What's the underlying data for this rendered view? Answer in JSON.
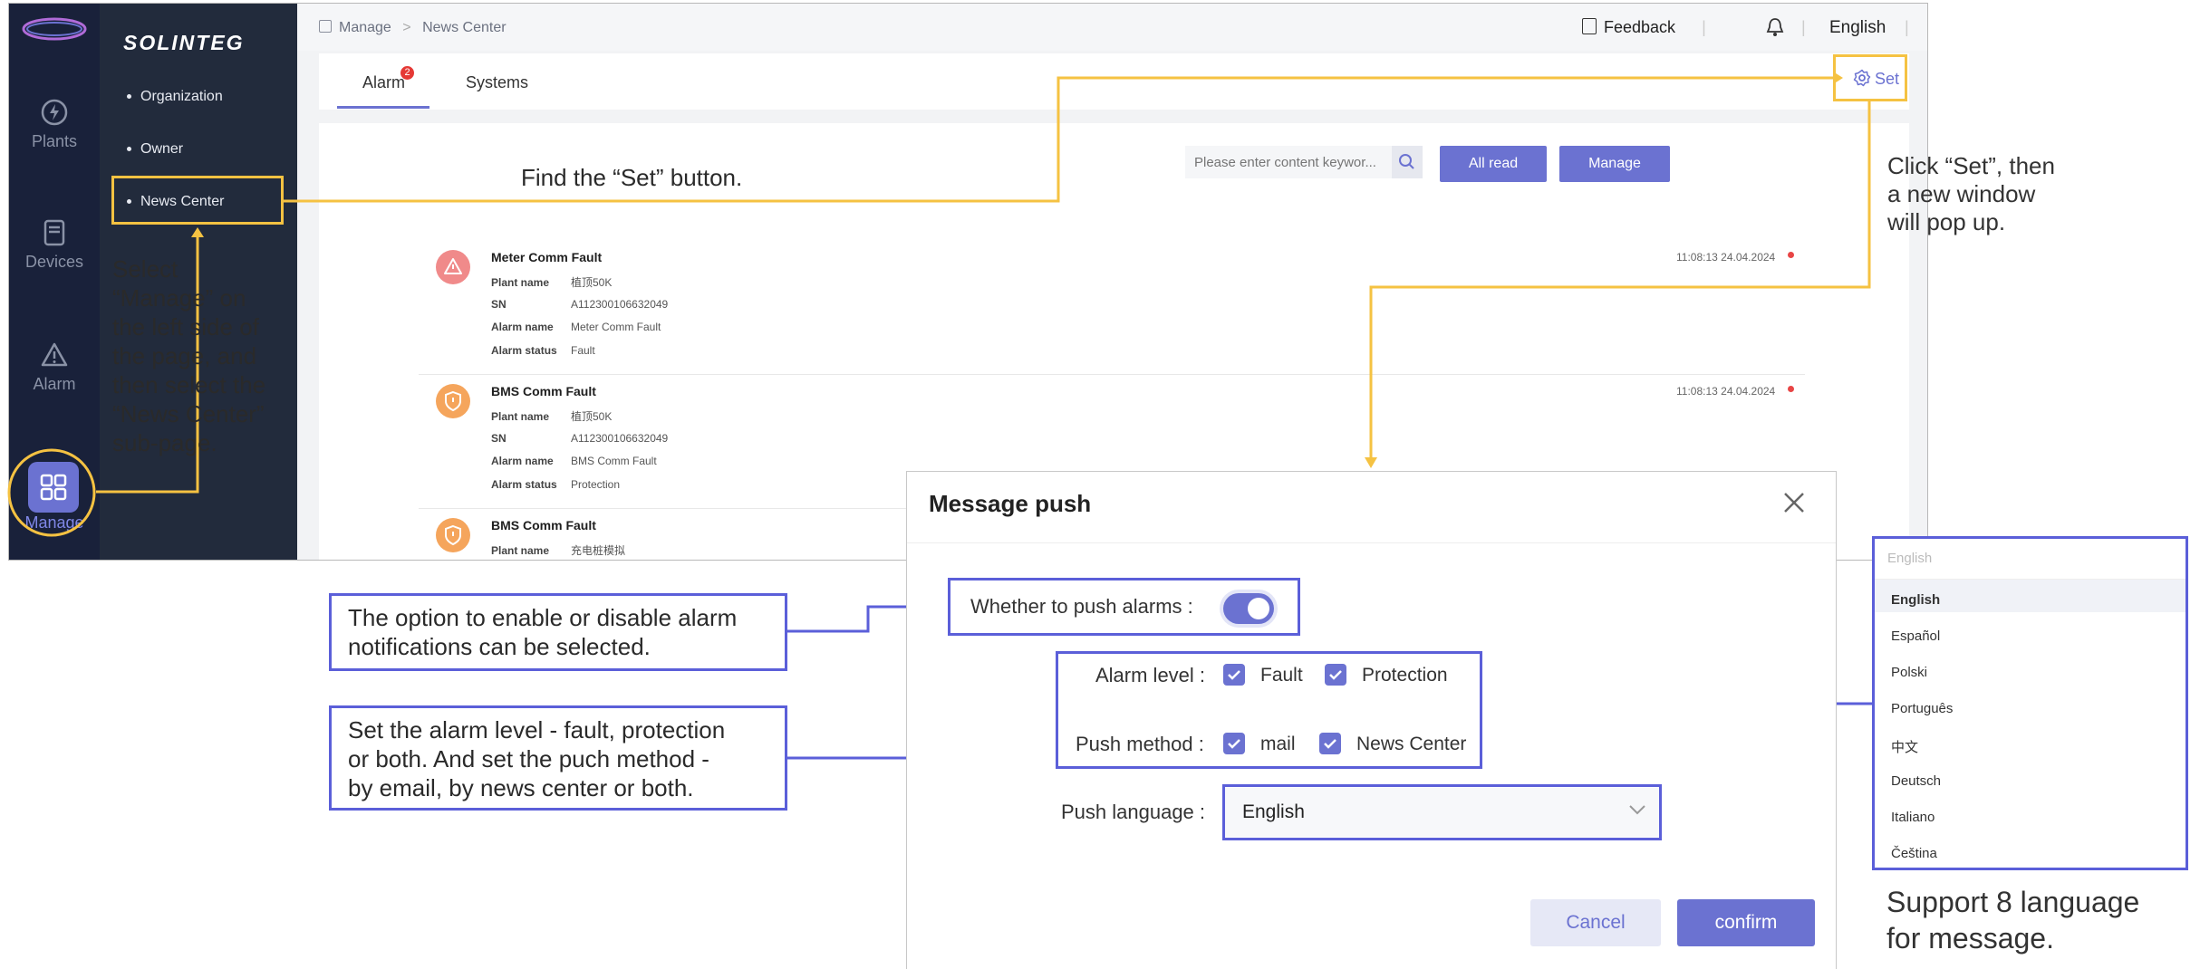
{
  "app": {
    "brand": "SOLINTEG",
    "rail": [
      {
        "label": "Plants",
        "icon": "plants-icon"
      },
      {
        "label": "Devices",
        "icon": "devices-icon"
      },
      {
        "label": "Alarm",
        "icon": "alarm-icon"
      },
      {
        "label": "Manage",
        "icon": "manage-icon"
      }
    ],
    "subnav": [
      "Organization",
      "Owner",
      "News Center"
    ],
    "breadcrumb": {
      "root": "Manage",
      "sep": ">",
      "current": "News Center"
    },
    "topbar": {
      "feedback": "Feedback",
      "language": "English"
    },
    "tabs": [
      {
        "label": "Alarm",
        "badge": "2"
      },
      {
        "label": "Systems"
      }
    ],
    "set_label": "Set",
    "search": {
      "placeholder": "Please enter content keywor..."
    },
    "buttons": {
      "all_read": "All read",
      "manage": "Manage"
    },
    "alarms": [
      {
        "title": "Meter Comm Fault",
        "time": "11:08:13 24.04.2024",
        "plant_label": "Plant name",
        "plant": "植顶50K",
        "sn_label": "SN",
        "sn": "A112300106632049",
        "name_label": "Alarm name",
        "name": "Meter Comm Fault",
        "status_label": "Alarm status",
        "status": "Fault"
      },
      {
        "title": "BMS Comm Fault",
        "time": "11:08:13 24.04.2024",
        "plant_label": "Plant name",
        "plant": "植顶50K",
        "sn_label": "SN",
        "sn": "A112300106632049",
        "name_label": "Alarm name",
        "name": "BMS Comm Fault",
        "status_label": "Alarm status",
        "status": "Protection"
      },
      {
        "title": "BMS Comm Fault",
        "plant_label": "Plant name",
        "plant": "充电桩模拟"
      }
    ]
  },
  "dialog": {
    "title": "Message push",
    "push_alarms_label": "Whether to push alarms :",
    "alarm_level_label": "Alarm level :",
    "alarm_levels": [
      "Fault",
      "Protection"
    ],
    "push_method_label": "Push method :",
    "push_methods": [
      "mail",
      "News Center"
    ],
    "push_language_label": "Push language :",
    "push_language_value": "English",
    "cancel": "Cancel",
    "confirm": "confirm"
  },
  "language_panel": {
    "placeholder": "English",
    "options": [
      "English",
      "Español",
      "Polski",
      "Português",
      "中文",
      "Deutsch",
      "Italiano",
      "Čeština"
    ]
  },
  "annotations": {
    "find_set": "Find the “Set” button.",
    "select_manage": [
      "Select",
      "“Manage” on",
      "the left side of",
      "the page, and",
      "then select the",
      "“News Center”",
      "sub-page."
    ],
    "click_set": [
      "Click “Set”, then",
      "a new window",
      "will pop up."
    ],
    "enable_note": [
      "The option to enable or disable alarm",
      "notifications can be selected."
    ],
    "level_note": [
      "Set the alarm level - fault, protection",
      "or both. And set the puch method -",
      "by email, by news center or both."
    ],
    "support_lang": [
      "Support 8 language",
      "for message."
    ]
  },
  "colors": {
    "accent": "#6b72d1",
    "annotation_yellow": "#f5c242",
    "annotation_blue": "#5b5fd9",
    "rail_bg": "#19213a",
    "subnav_bg": "#222b3c"
  }
}
